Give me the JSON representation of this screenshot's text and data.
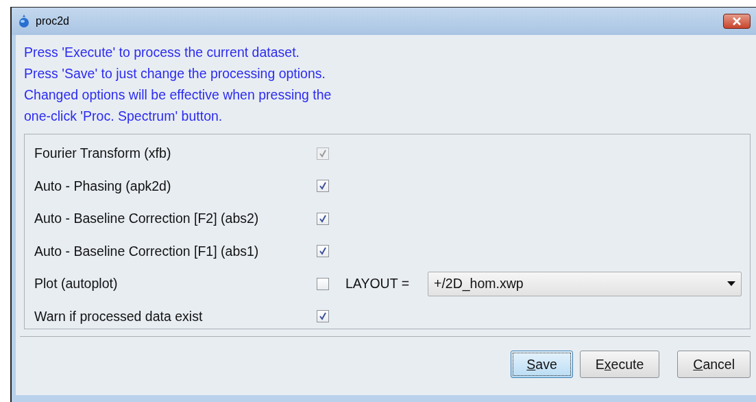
{
  "window": {
    "title": "proc2d"
  },
  "message": [
    "Press 'Execute' to process the current dataset.",
    "Press 'Save' to just change the processing options.",
    "Changed options will be effective when pressing the",
    "one-click 'Proc. Spectrum' button."
  ],
  "options": [
    {
      "label": "Fourier Transform (xfb)",
      "checked": true,
      "disabled": true
    },
    {
      "label": "Auto - Phasing (apk2d)",
      "checked": true,
      "disabled": false
    },
    {
      "label": "Auto - Baseline Correction [F2] (abs2)",
      "checked": true,
      "disabled": false
    },
    {
      "label": "Auto - Baseline Correction [F1] (abs1)",
      "checked": true,
      "disabled": false
    },
    {
      "label": "Plot (autoplot)",
      "checked": false,
      "disabled": false,
      "field": {
        "label": "LAYOUT =",
        "value": "+/2D_hom.xwp"
      }
    },
    {
      "label": "Warn if processed data exist",
      "checked": true,
      "disabled": false
    }
  ],
  "buttons": [
    {
      "key": "S",
      "after": "ave",
      "focused": true
    },
    {
      "before": "E",
      "key": "x",
      "after": "ecute",
      "focused": false
    },
    {
      "key": "C",
      "after": "ancel",
      "focused": false
    }
  ]
}
